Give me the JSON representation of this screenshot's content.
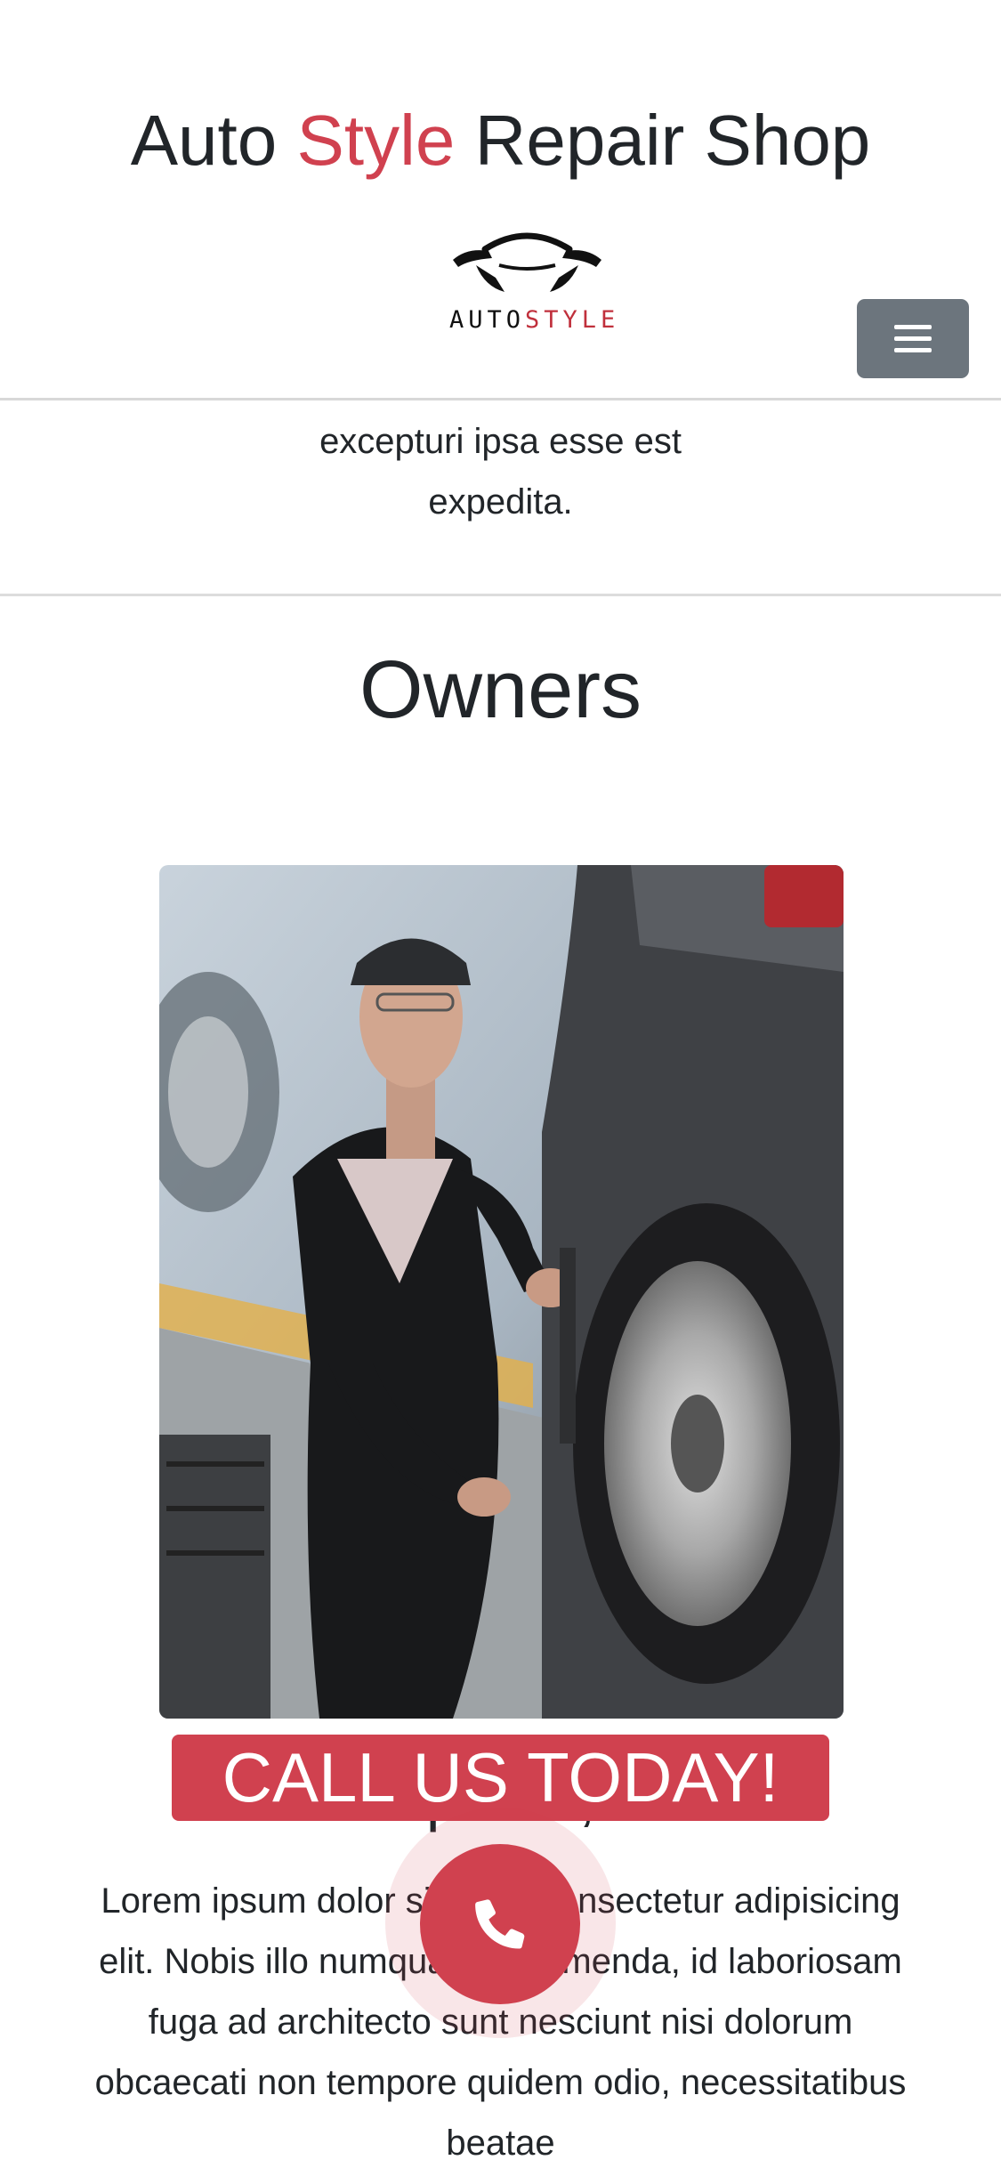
{
  "header": {
    "title_part1": "Auto ",
    "title_accent": "Style",
    "title_part2": " Repair Shop",
    "logo_text_black": "AUTO",
    "logo_text_red": "STYLE",
    "logo_icon": "car-silhouette-icon",
    "menu_icon": "hamburger-icon"
  },
  "previous_section": {
    "text_line1": "excepturi ipsa esse est",
    "text_line2": "expedita."
  },
  "owners": {
    "title": "Owners",
    "photo_icon": "mechanic-photo",
    "name": "Lorem ipsum, owner",
    "bio": "Lorem ipsum dolor sit amet consectetur adipisicing elit. Nobis illo numquam assumenda, id laboriosam fuga ad architecto sunt nesciunt nisi dolorum obcaecati non tempore quidem odio, necessitatibus beatae"
  },
  "cta": {
    "label": "CALL US TODAY!",
    "call_icon": "phone-icon"
  },
  "colors": {
    "accent": "#d0414f",
    "menu_button": "#6c757d",
    "text": "#212529"
  }
}
